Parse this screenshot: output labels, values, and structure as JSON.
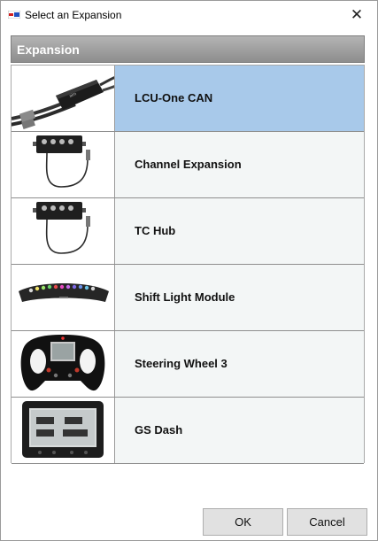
{
  "window": {
    "title": "Select an Expansion",
    "close_glyph": "✕"
  },
  "section": {
    "header": "Expansion"
  },
  "expansions": [
    {
      "label": "LCU-One CAN",
      "icon": "lcu-one-can-icon",
      "selected": true
    },
    {
      "label": "Channel Expansion",
      "icon": "channel-expansion-icon",
      "selected": false
    },
    {
      "label": "TC Hub",
      "icon": "tc-hub-icon",
      "selected": false
    },
    {
      "label": "Shift Light Module",
      "icon": "shift-light-module-icon",
      "selected": false
    },
    {
      "label": "Steering Wheel 3",
      "icon": "steering-wheel-icon",
      "selected": false
    },
    {
      "label": "GS Dash",
      "icon": "gs-dash-icon",
      "selected": false
    }
  ],
  "buttons": {
    "ok": "OK",
    "cancel": "Cancel"
  },
  "colors": {
    "selected_row": "#a8c9ea",
    "row": "#f3f6f6",
    "header": "#9c9c9c"
  }
}
